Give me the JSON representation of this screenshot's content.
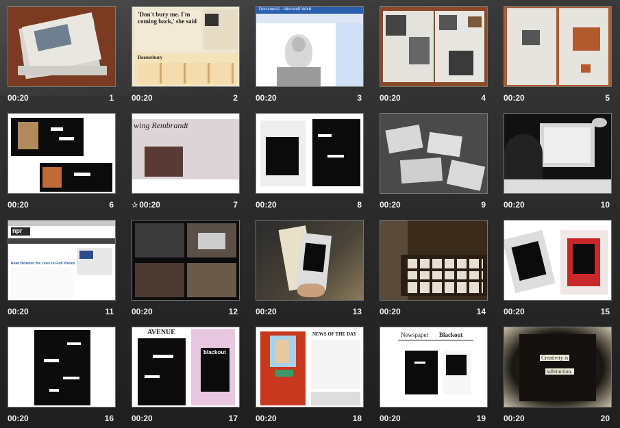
{
  "slides": [
    {
      "number": "1",
      "timing": "00:20",
      "thumb": "newspaper-stack"
    },
    {
      "number": "2",
      "timing": "00:20",
      "thumb": "newspaper-clipping",
      "headline": "'Don't bury me. I'm coming back,' she said",
      "strip_title": "Doonesbury"
    },
    {
      "number": "3",
      "timing": "00:20",
      "thumb": "word-document-screenshot",
      "window_title": "Document1 - Microsoft Word"
    },
    {
      "number": "4",
      "timing": "00:20",
      "thumb": "scrapbook-collage"
    },
    {
      "number": "5",
      "timing": "00:20",
      "thumb": "cutout-newspaper"
    },
    {
      "number": "6",
      "timing": "00:20",
      "thumb": "blackout-houses"
    },
    {
      "number": "7",
      "timing": "00:20",
      "thumb": "newspaper-closeup",
      "starred": true,
      "headline": "wing Rembrandt"
    },
    {
      "number": "8",
      "timing": "00:20",
      "thumb": "redacted-documents"
    },
    {
      "number": "9",
      "timing": "00:20",
      "thumb": "desk-clippings"
    },
    {
      "number": "10",
      "timing": "00:20",
      "thumb": "computer-desk"
    },
    {
      "number": "11",
      "timing": "00:20",
      "thumb": "npr-website",
      "brand": "npr",
      "headline": "Read Between the Lines to Find Poems"
    },
    {
      "number": "12",
      "timing": "00:20",
      "thumb": "video-stills"
    },
    {
      "number": "13",
      "timing": "00:20",
      "thumb": "hand-with-clippings"
    },
    {
      "number": "14",
      "timing": "00:20",
      "thumb": "table-of-poems"
    },
    {
      "number": "15",
      "timing": "00:20",
      "thumb": "card-stacks"
    },
    {
      "number": "16",
      "timing": "00:20",
      "thumb": "blackout-poem"
    },
    {
      "number": "17",
      "timing": "00:20",
      "thumb": "magazine-blackouts",
      "mag_title": "AVENUE",
      "mag_title2": "blackout"
    },
    {
      "number": "18",
      "timing": "00:20",
      "thumb": "newspaper-layout",
      "headline": "NEWS OF THE DAY"
    },
    {
      "number": "19",
      "timing": "00:20",
      "thumb": "blackout-website",
      "title_a": "Newspaper",
      "title_b": "Blackout"
    },
    {
      "number": "20",
      "timing": "00:20",
      "thumb": "creativity-poem",
      "words_a": "Creativity is",
      "words_b": "subtraction."
    }
  ],
  "icons": {
    "animation_star": "star-icon"
  }
}
